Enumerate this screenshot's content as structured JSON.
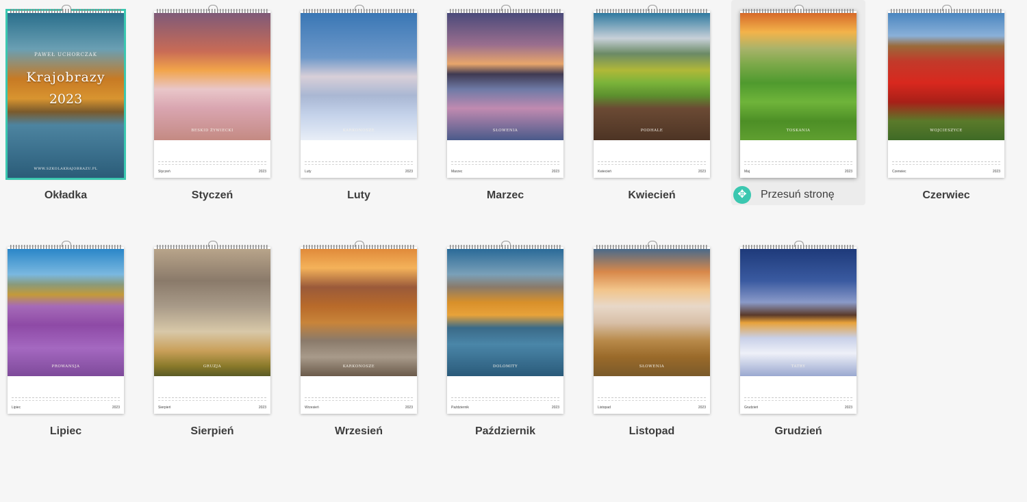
{
  "pages": [
    {
      "id": "cover",
      "label": "Okładka",
      "author": "Paweł Uchorczak",
      "title": "Krajobrazy",
      "year": "2023",
      "url": "www.szkolakrajobrazu.pl"
    },
    {
      "label": "Styczeń",
      "photo_label": "Beskid Żywiecki",
      "month": "Styczeń",
      "year": "2023"
    },
    {
      "label": "Luty",
      "photo_label": "Karkonosze",
      "month": "Luty",
      "year": "2023"
    },
    {
      "label": "Marzec",
      "photo_label": "Słowenia",
      "month": "Marzec",
      "year": "2023"
    },
    {
      "label": "Kwiecień",
      "photo_label": "Podhale",
      "month": "Kwiecień",
      "year": "2023"
    },
    {
      "label": "Przesuń stronę",
      "photo_label": "Toskania",
      "month": "Maj",
      "year": "2023"
    },
    {
      "label": "Czerwiec",
      "photo_label": "Wojcieszyce",
      "month": "Czerwiec",
      "year": "2023"
    },
    {
      "label": "Lipiec",
      "photo_label": "Prowansja",
      "month": "Lipiec",
      "year": "2023"
    },
    {
      "label": "Sierpień",
      "photo_label": "Gruzja",
      "month": "Sierpień",
      "year": "2023"
    },
    {
      "label": "Wrzesień",
      "photo_label": "Karkonosze",
      "month": "Wrzesień",
      "year": "2023"
    },
    {
      "label": "Październik",
      "photo_label": "Dolomity",
      "month": "Październik",
      "year": "2023"
    },
    {
      "label": "Listopad",
      "photo_label": "Słowenia",
      "month": "Listopad",
      "year": "2023"
    },
    {
      "label": "Grudzień",
      "photo_label": "Tatry",
      "month": "Grudzień",
      "year": "2023"
    }
  ],
  "colors": {
    "accent": "#3bc7b0",
    "background": "#f6f6f6",
    "label": "#3d3d3d"
  },
  "icons": {
    "move": "move-arrows-icon"
  }
}
